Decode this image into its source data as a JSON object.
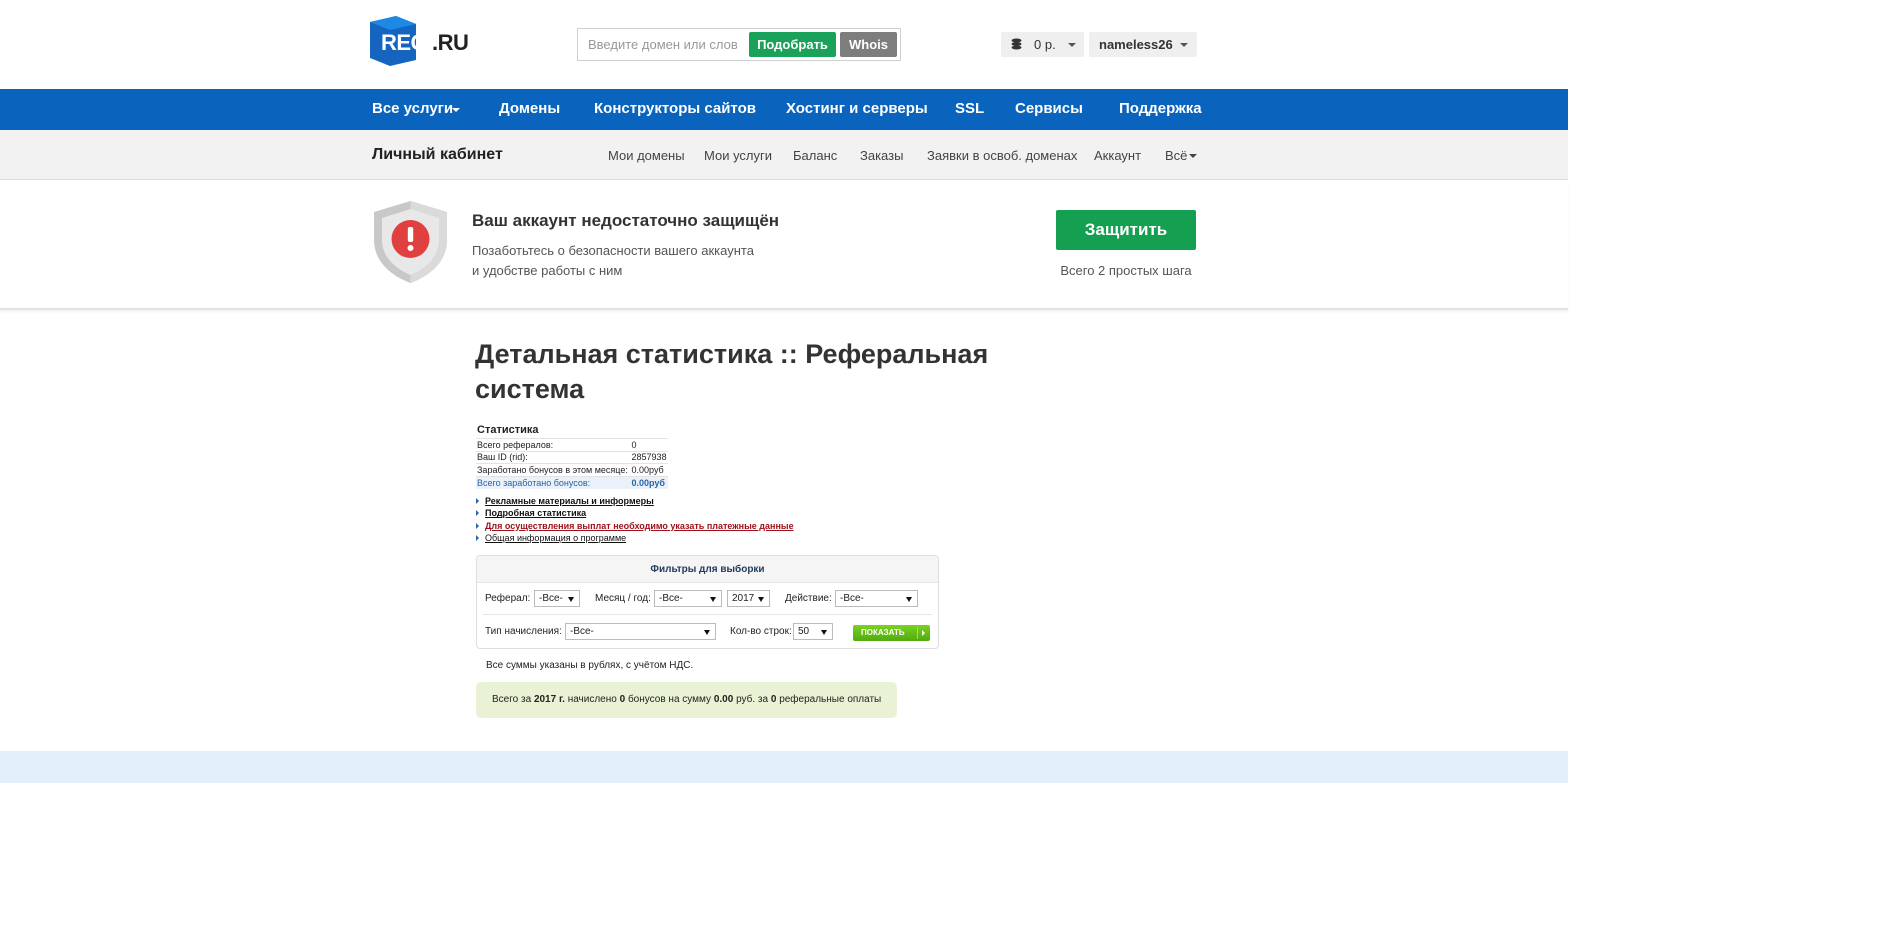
{
  "header": {
    "logo_text": "REG",
    "logo_suffix": ".RU",
    "search_placeholder": "Введите домен или слово",
    "search_button": "Подобрать",
    "whois_button": "Whois",
    "balance": "0 р.",
    "username": "nameless26"
  },
  "main_nav": [
    "Все услуги",
    "Домены",
    "Конструкторы сайтов",
    "Хостинг и серверы",
    "SSL",
    "Сервисы",
    "Поддержка"
  ],
  "sub_nav": {
    "title": "Личный кабинет",
    "items": [
      "Мои домены",
      "Мои услуги",
      "Баланс",
      "Заказы",
      "Заявки в освоб. доменах",
      "Аккаунт",
      "Всё"
    ]
  },
  "security_banner": {
    "title": "Ваш аккаунт недостаточно защищён",
    "text_line1": "Позаботьтесь о безопасности вашего аккаунта",
    "text_line2": "и удобстве работы с ним",
    "button": "Защитить",
    "steps_note": "Всего 2 простых шага"
  },
  "page": {
    "title": "Детальная статистика :: Реферальная система"
  },
  "stats": {
    "title": "Статистика",
    "rows": [
      {
        "label": "Всего рефералов:",
        "value": "0"
      },
      {
        "label": "Ваш ID (rid):",
        "value": "2857938"
      },
      {
        "label": "Заработано бонусов в этом месяце:",
        "value": "0.00руб"
      },
      {
        "label": "Всего заработано бонусов:",
        "value": "0.00руб"
      }
    ]
  },
  "links": [
    "Рекламные материалы и информеры",
    "Подробная статистика",
    "Для осуществления выплат необходимо указать платежные данные",
    "Общая информация о программе"
  ],
  "filters": {
    "title": "Фильтры для выборки",
    "referral_label": "Реферал:",
    "referral_value": "-Все-",
    "month_year_label": "Месяц / год:",
    "month_value": "-Все-",
    "year_value": "2017",
    "action_label": "Действие:",
    "action_value": "-Все-",
    "accrual_type_label": "Тип начисления:",
    "accrual_type_value": "-Все-",
    "rows_label": "Кол-во строк:",
    "rows_value": "50",
    "show_button": "ПОКАЗАТЬ"
  },
  "note": "Все суммы указаны в рублях, с учётом НДС.",
  "summary": {
    "prefix": "Всего за",
    "year": "2017 г.",
    "mid1": "начислено",
    "bonuses": "0",
    "mid2": "бонусов на сумму",
    "amount": "0.00",
    "mid3": "руб. за",
    "payments": "0",
    "suffix": "реферальные оплаты"
  },
  "colors": {
    "brand_blue": "#0a64be",
    "accent_green": "#14a050",
    "whois_gray": "#7d7d7d",
    "alert_red": "#e04040"
  }
}
